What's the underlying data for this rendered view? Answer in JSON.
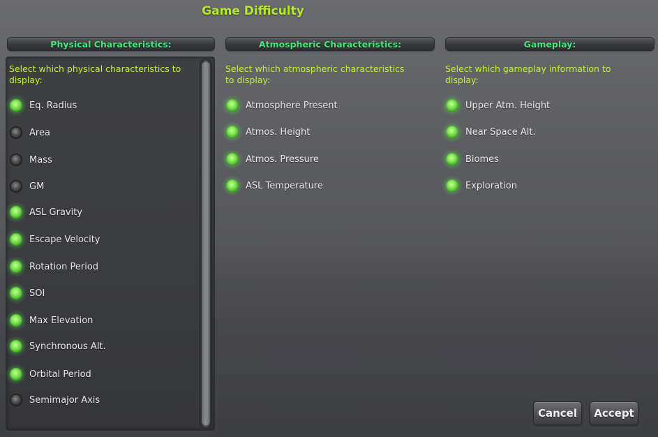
{
  "window": {
    "title": "Game Difficulty"
  },
  "physical": {
    "header": "Physical Characteristics:",
    "instructions": "Select which physical characteristics to display:",
    "options": [
      {
        "label": "Eq. Radius",
        "checked": true
      },
      {
        "label": "Area",
        "checked": false
      },
      {
        "label": "Mass",
        "checked": false
      },
      {
        "label": "GM",
        "checked": false
      },
      {
        "label": "ASL Gravity",
        "checked": true
      },
      {
        "label": "Escape Velocity",
        "checked": true
      },
      {
        "label": "Rotation Period",
        "checked": true
      },
      {
        "label": "SOI",
        "checked": true
      },
      {
        "label": "Max Elevation",
        "checked": true
      },
      {
        "label": "Synchronous Alt.",
        "checked": true
      },
      {
        "label": "Orbital Period",
        "checked": true
      },
      {
        "label": "Semimajor Axis",
        "checked": false
      }
    ]
  },
  "atmospheric": {
    "header": "Atmospheric Characteristics:",
    "instructions": "Select which atmospheric characteristics to display:",
    "options": [
      {
        "label": "Atmosphere Present",
        "checked": true
      },
      {
        "label": "Atmos. Height",
        "checked": true
      },
      {
        "label": "Atmos. Pressure",
        "checked": true
      },
      {
        "label": "ASL Temperature",
        "checked": true
      }
    ]
  },
  "gameplay": {
    "header": "Gameplay:",
    "instructions": "Select which gameplay information to display:",
    "options": [
      {
        "label": "Upper Atm. Height",
        "checked": true
      },
      {
        "label": "Near Space Alt.",
        "checked": true
      },
      {
        "label": "Biomes",
        "checked": true
      },
      {
        "label": "Exploration",
        "checked": true
      }
    ]
  },
  "buttons": {
    "cancel": "Cancel",
    "accept": "Accept"
  },
  "colors": {
    "title": "#b6e82a",
    "header_text": "#3ee87a",
    "instruction_text": "#c2ef3a",
    "toggle_on": "#7fe850",
    "toggle_off": "#4a4a4a"
  }
}
